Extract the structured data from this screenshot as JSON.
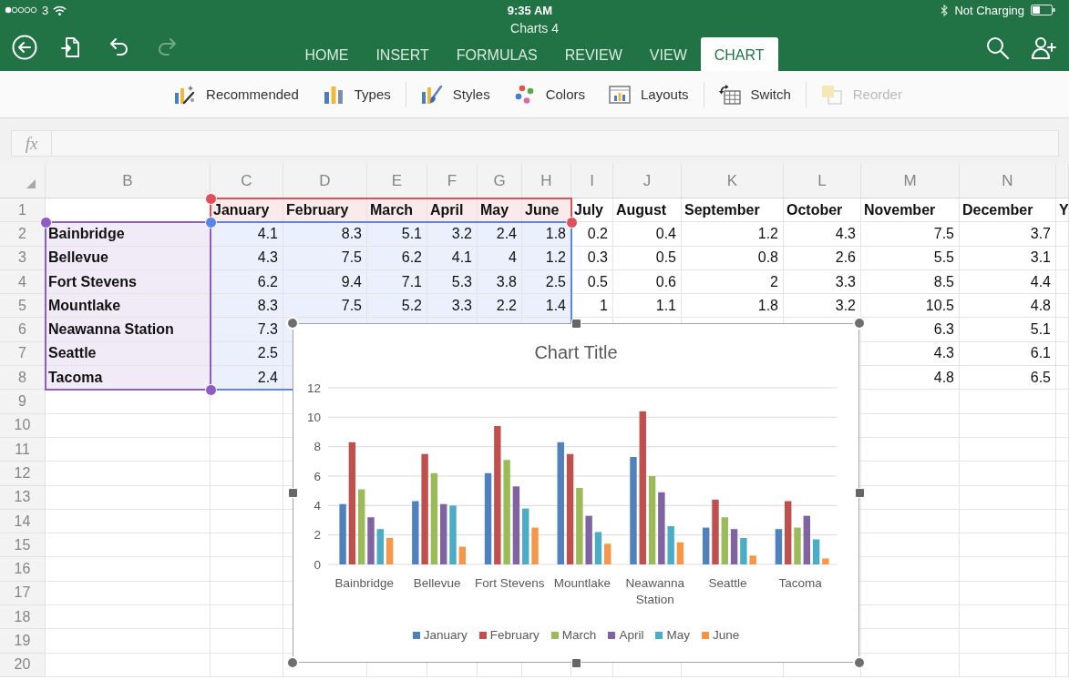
{
  "status_bar": {
    "carrier": "3",
    "time": "9:35 AM",
    "battery_text": "Not Charging"
  },
  "window": {
    "title": "Charts 4"
  },
  "nav_buttons": [
    {
      "kind": "back",
      "disabled": false
    },
    {
      "kind": "document",
      "disabled": false
    },
    {
      "kind": "undo",
      "disabled": false
    },
    {
      "kind": "redo",
      "disabled": true
    }
  ],
  "tabs": [
    {
      "label": "HOME",
      "selected": false
    },
    {
      "label": "INSERT",
      "selected": false
    },
    {
      "label": "FORMULAS",
      "selected": false
    },
    {
      "label": "REVIEW",
      "selected": false
    },
    {
      "label": "VIEW",
      "selected": false
    },
    {
      "label": "CHART",
      "selected": true
    }
  ],
  "header_actions": [
    {
      "kind": "search"
    },
    {
      "kind": "add_person"
    }
  ],
  "ribbon": {
    "groups": [
      {
        "items": [
          {
            "kind": "recommended",
            "label": "Recommended",
            "disabled": false
          },
          {
            "kind": "types",
            "label": "Types",
            "disabled": false
          }
        ]
      },
      {
        "items": [
          {
            "kind": "styles",
            "label": "Styles",
            "disabled": false
          },
          {
            "kind": "colors",
            "label": "Colors",
            "disabled": false
          },
          {
            "kind": "layouts",
            "label": "Layouts",
            "disabled": false
          }
        ]
      },
      {
        "items": [
          {
            "kind": "switch",
            "label": "Switch",
            "disabled": false
          }
        ]
      },
      {
        "items": [
          {
            "kind": "reorder",
            "label": "Reorder",
            "disabled": true
          }
        ]
      }
    ]
  },
  "formula_bar": {
    "label": "fx"
  },
  "sheet": {
    "columns": [
      "B",
      "C",
      "D",
      "E",
      "F",
      "G",
      "H",
      "I",
      "J",
      "K",
      "L",
      "M",
      "N"
    ],
    "rows": [
      {
        "number": "1",
        "cells": [
          null,
          "January",
          "February",
          "March",
          "April",
          "May",
          "June",
          "July",
          "August",
          "September",
          "October",
          "November",
          "December",
          "Y"
        ]
      },
      {
        "number": "2",
        "cells": [
          "Bainbridge",
          "4.1",
          "8.3",
          "5.1",
          "3.2",
          "2.4",
          "1.8",
          "0.2",
          "0.4",
          "1.2",
          "4.3",
          "7.5",
          "3.7"
        ]
      },
      {
        "number": "3",
        "cells": [
          "Bellevue",
          "4.3",
          "7.5",
          "6.2",
          "4.1",
          "4",
          "1.2",
          "0.3",
          "0.5",
          "0.8",
          "2.6",
          "5.5",
          "3.1"
        ]
      },
      {
        "number": "4",
        "cells": [
          "Fort Stevens",
          "6.2",
          "9.4",
          "7.1",
          "5.3",
          "3.8",
          "2.5",
          "0.5",
          "0.6",
          "2",
          "3.3",
          "8.5",
          "4.4"
        ]
      },
      {
        "number": "5",
        "cells": [
          "Mountlake",
          "8.3",
          "7.5",
          "5.2",
          "3.3",
          "2.2",
          "1.4",
          "1",
          "1.1",
          "1.8",
          "3.2",
          "10.5",
          "4.8"
        ]
      },
      {
        "number": "6",
        "cells": [
          "Neawanna Station",
          "7.3",
          null,
          null,
          null,
          null,
          null,
          null,
          null,
          null,
          null,
          "6.3",
          "5.1"
        ]
      },
      {
        "number": "7",
        "cells": [
          "Seattle",
          "2.5",
          null,
          null,
          null,
          null,
          null,
          null,
          null,
          null,
          null,
          "4.3",
          "6.1"
        ]
      },
      {
        "number": "8",
        "cells": [
          "Tacoma",
          "2.4",
          null,
          null,
          null,
          null,
          null,
          null,
          null,
          null,
          null,
          "4.8",
          "6.5"
        ]
      },
      {
        "number": "9"
      },
      {
        "number": "10"
      },
      {
        "number": "11"
      },
      {
        "number": "12"
      },
      {
        "number": "13"
      },
      {
        "number": "14"
      },
      {
        "number": "15"
      },
      {
        "number": "16"
      },
      {
        "number": "17"
      },
      {
        "number": "18"
      },
      {
        "number": "19"
      },
      {
        "number": "20"
      }
    ],
    "highlights": [
      {
        "kind": "series_names",
        "color": "#e0505c"
      },
      {
        "kind": "values",
        "color": "#5b86e5"
      },
      {
        "kind": "categories",
        "color": "#8e5cc6"
      }
    ]
  },
  "chart": {
    "chart_data": {
      "type": "bar",
      "title": "Chart Title",
      "categories": [
        "Bainbridge",
        "Bellevue",
        "Fort Stevens",
        "Mountlake",
        "Neawanna Station",
        "Seattle",
        "Tacoma"
      ],
      "series": [
        {
          "name": "January",
          "color": "#4f81bd",
          "values": [
            4.1,
            4.3,
            6.2,
            8.3,
            7.3,
            2.5,
            2.4
          ]
        },
        {
          "name": "February",
          "color": "#c0504d",
          "values": [
            8.3,
            7.5,
            9.4,
            7.5,
            10.4,
            4.4,
            4.3
          ]
        },
        {
          "name": "March",
          "color": "#9bbb59",
          "values": [
            5.1,
            6.2,
            7.1,
            5.2,
            6.0,
            3.2,
            2.5
          ]
        },
        {
          "name": "April",
          "color": "#8064a2",
          "values": [
            3.2,
            4.1,
            5.3,
            3.3,
            4.9,
            2.4,
            3.3
          ]
        },
        {
          "name": "May",
          "color": "#4bacc6",
          "values": [
            2.4,
            4,
            3.8,
            2.2,
            2.6,
            1.8,
            1.7
          ]
        },
        {
          "name": "June",
          "color": "#f79646",
          "values": [
            1.8,
            1.2,
            2.5,
            1.4,
            1.5,
            0.6,
            0.4
          ]
        }
      ],
      "ylim": [
        0,
        12
      ],
      "yticks": [
        {
          "value": 0,
          "label": "0"
        },
        {
          "value": 2,
          "label": "2"
        },
        {
          "value": 4,
          "label": "4"
        },
        {
          "value": 6,
          "label": "6"
        },
        {
          "value": 8,
          "label": "8"
        },
        {
          "value": 10,
          "label": "10"
        },
        {
          "value": 12,
          "label": "12"
        }
      ],
      "grid": true,
      "legend": "bottom"
    }
  }
}
